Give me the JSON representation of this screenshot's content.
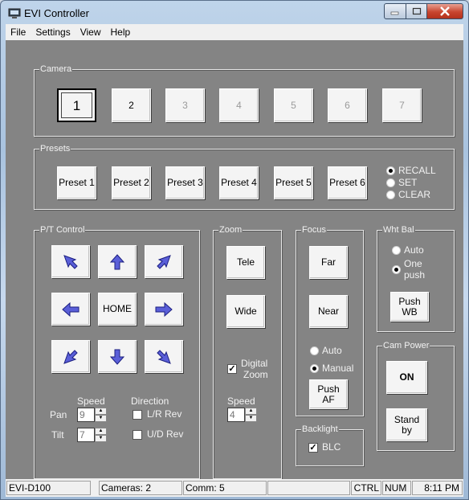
{
  "window": {
    "title": "EVI Controller"
  },
  "menu": [
    "File",
    "Settings",
    "View",
    "Help"
  ],
  "camera": {
    "group_title": "Camera",
    "buttons": [
      "1",
      "2",
      "3",
      "4",
      "5",
      "6",
      "7"
    ],
    "selected": "1"
  },
  "presets": {
    "group_title": "Presets",
    "buttons": [
      "Preset 1",
      "Preset 2",
      "Preset 3",
      "Preset 4",
      "Preset 5",
      "Preset 6"
    ],
    "modes": [
      "RECALL",
      "SET",
      "CLEAR"
    ],
    "selected_mode": "RECALL"
  },
  "pt": {
    "group_title": "P/T Control",
    "home_label": "HOME",
    "speed_label": "Speed",
    "direction_label": "Direction",
    "pan_label": "Pan",
    "tilt_label": "Tilt",
    "pan_speed": "9",
    "tilt_speed": "7",
    "lr_rev_label": "L/R Rev",
    "ud_rev_label": "U/D Rev",
    "lr_rev_checked": false,
    "ud_rev_checked": false
  },
  "zoom": {
    "group_title": "Zoom",
    "tele_label": "Tele",
    "wide_label": "Wide",
    "digital_zoom_label_1": "Digital",
    "digital_zoom_label_2": "Zoom",
    "digital_zoom_checked": true,
    "speed_label": "Speed",
    "speed_value": "4"
  },
  "focus": {
    "group_title": "Focus",
    "far_label": "Far",
    "near_label": "Near",
    "auto_label": "Auto",
    "manual_label": "Manual",
    "selected_mode": "Manual",
    "push_af_line1": "Push",
    "push_af_line2": "AF"
  },
  "backlight": {
    "group_title": "Backlight",
    "blc_label": "BLC",
    "blc_checked": true
  },
  "whtbal": {
    "group_title": "Wht Bal",
    "auto_label": "Auto",
    "onepush_line1": "One",
    "onepush_line2": "push",
    "selected_mode": "One push",
    "push_wb_line1": "Push",
    "push_wb_line2": "WB"
  },
  "campower": {
    "group_title": "Cam Power",
    "on_label": "ON",
    "standby_line1": "Stand",
    "standby_line2": "by"
  },
  "status": {
    "model": "EVI-D100",
    "cameras": "Cameras:  2",
    "comm": "Comm:  5",
    "empty": "",
    "ctrl": "CTRL",
    "num": "NUM",
    "time": "8:11 PM"
  },
  "colors": {
    "panel": "#848484",
    "arrow": "#5a5fd8",
    "close": "#c8452f"
  }
}
